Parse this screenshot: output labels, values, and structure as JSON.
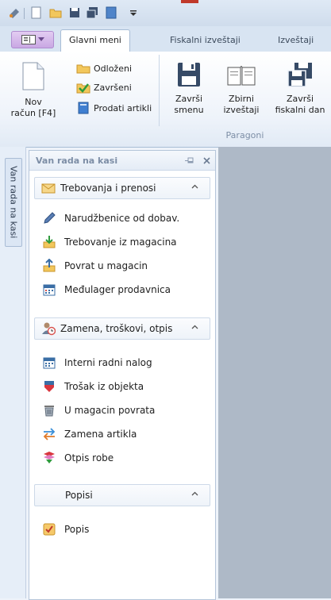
{
  "tabs": {
    "app_menu_icon": "ribbon-app-menu-icon",
    "items": [
      {
        "label": "Glavni meni",
        "active": true
      },
      {
        "label": "Fiskalni izveštaji",
        "active": false
      },
      {
        "label": "Izveštaji",
        "active": false
      }
    ]
  },
  "ribbon": {
    "new_receipt": {
      "line1": "Nov",
      "line2": "račun [F4]"
    },
    "small_buttons": [
      {
        "label": "Odloženi"
      },
      {
        "label": "Završeni"
      },
      {
        "label": "Prodati artikli"
      }
    ],
    "finish_shift": {
      "line1": "Završi",
      "line2": "smenu"
    },
    "summary_report": {
      "line1": "Zbirni",
      "line2": "izveštaji"
    },
    "finish_day": {
      "line1": "Završi",
      "line2": "fiskalni dan"
    },
    "group_label": "Paragoni"
  },
  "vertical_tab": {
    "label": "Van rada na kasi"
  },
  "panel": {
    "title": "Van rada na kasi",
    "sections": [
      {
        "title": "Trebovanja i prenosi",
        "items": [
          {
            "label": "Narudžbenice od dobav."
          },
          {
            "label": "Trebovanje iz magacina"
          },
          {
            "label": "Povrat u magacin"
          },
          {
            "label": "Međulager prodavnica"
          }
        ]
      },
      {
        "title": "Zamena, troškovi, otpis",
        "items": [
          {
            "label": "Interni radni nalog"
          },
          {
            "label": "Trošak iz objekta"
          },
          {
            "label": "U magacin povrata"
          },
          {
            "label": "Zamena artikla"
          },
          {
            "label": "Otpis robe"
          }
        ]
      },
      {
        "title": "Popisi",
        "items": [
          {
            "label": "Popis"
          }
        ]
      }
    ]
  },
  "colors": {
    "accent": "#3a6ea5",
    "workspace": "#aeb9c7",
    "app_button": "#c9a8e3"
  }
}
